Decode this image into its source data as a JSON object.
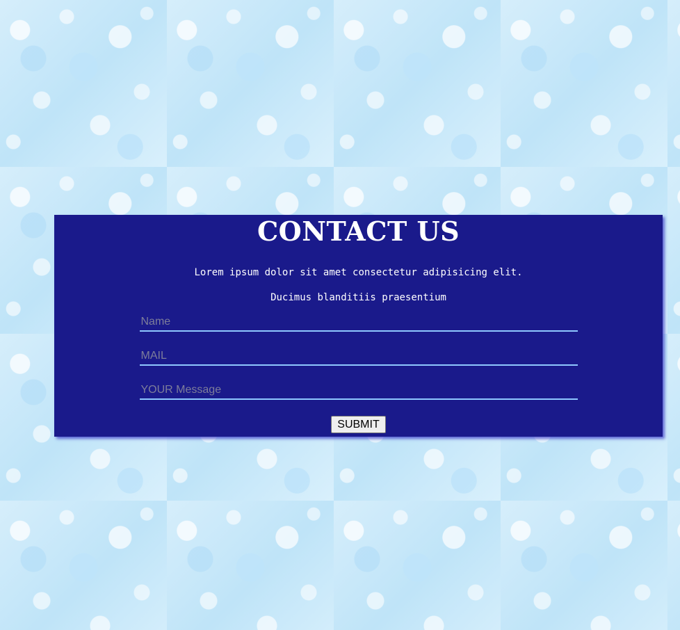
{
  "contact": {
    "title": "CONTACT US",
    "intro_line1": "Lorem ipsum dolor sit amet consectetur adipisicing elit.",
    "intro_line2": "Ducimus blanditiis praesentium",
    "fields": {
      "name": {
        "placeholder": "Name",
        "value": ""
      },
      "mail": {
        "placeholder": "MAIL",
        "value": ""
      },
      "message": {
        "placeholder": "YOUR Message",
        "value": ""
      }
    },
    "submit_label": "SUBMIT"
  },
  "colors": {
    "panel_background": "#1a1a8b",
    "field_underline": "#8fc8ff",
    "page_background": "#cfeaf9"
  }
}
